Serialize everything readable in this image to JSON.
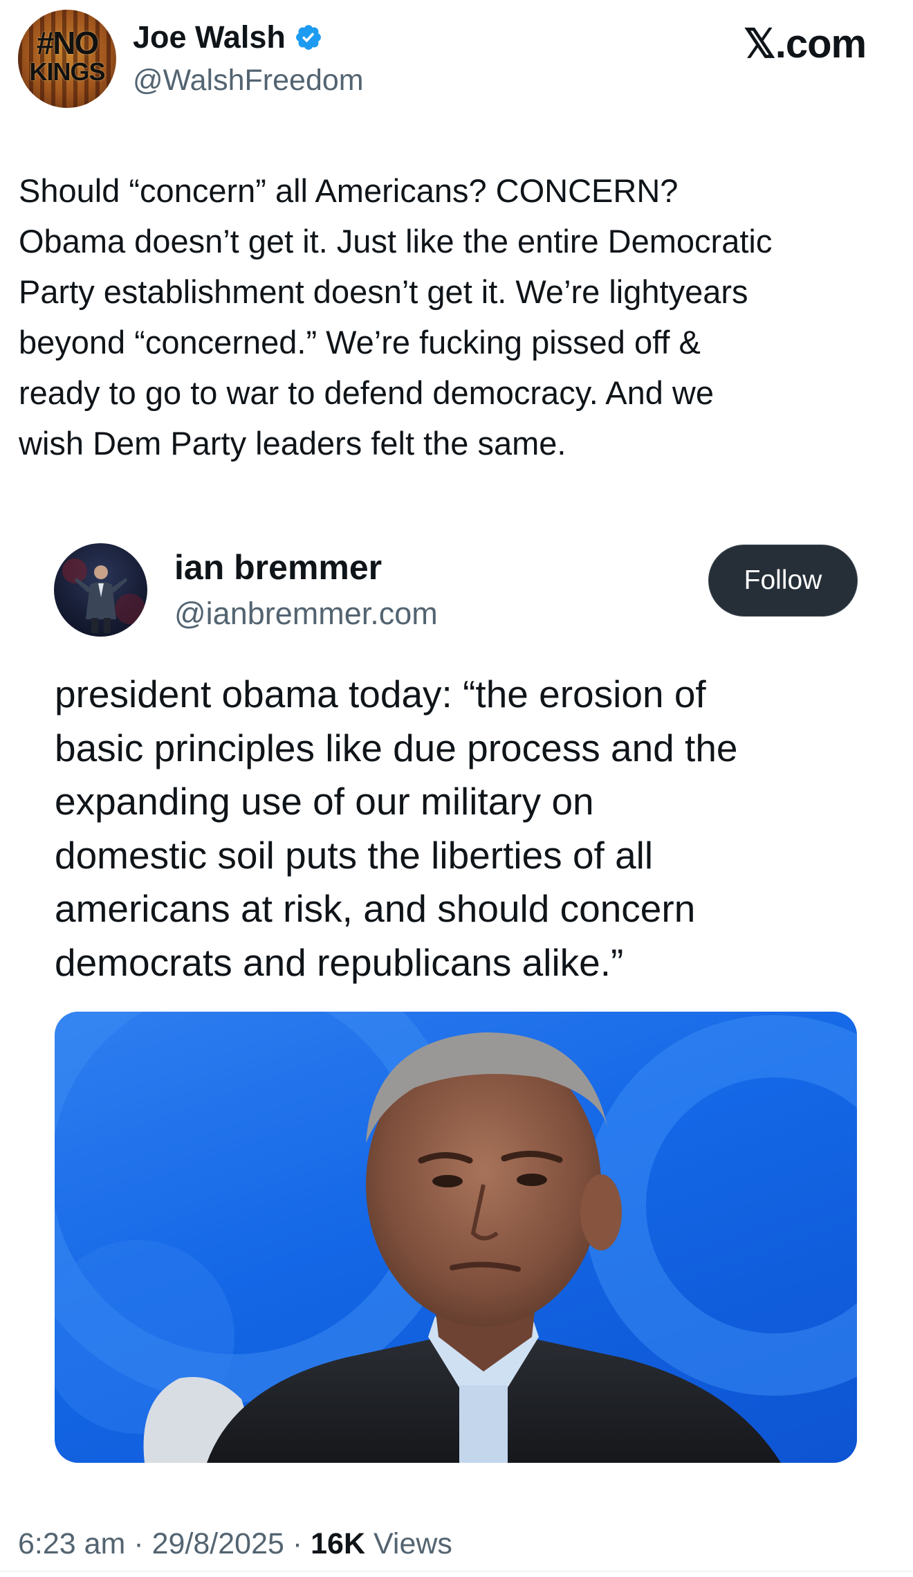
{
  "main_tweet": {
    "author_name": "Joe Walsh",
    "handle": "@WalshFreedom",
    "avatar_text": [
      "#NO",
      "KINGS"
    ],
    "verified_icon": "verified-badge-icon",
    "verified_color": "#1d9bf0",
    "lines": [
      "Should “concern” all Americans? CONCERN?",
      "Obama doesn’t get it. Just like the entire Democratic",
      "Party establishment doesn’t get it. We’re lightyears",
      "beyond “concerned.” We’re fucking pissed off &",
      "ready to go to war to defend democracy. And we",
      "wish Dem Party leaders felt the same."
    ]
  },
  "site_label": "𝕏.com",
  "quoted_tweet": {
    "author_name": "ian bremmer",
    "handle": "@ianbremmer.com",
    "follow_label": "Follow",
    "lines": [
      "president obama today: “the erosion of",
      "basic principles like due process and the",
      "expanding use of our military on",
      "domestic soil puts the liberties of all",
      "americans at risk, and should concern",
      "democrats and republicans alike.”"
    ]
  },
  "footer": {
    "time": "6:23 am",
    "separator": "·",
    "date": "29/8/2025",
    "views_count": "16K",
    "views_label": "Views"
  },
  "colors": {
    "text": "#0f1419",
    "secondary": "#536471",
    "follow_bg": "#262f38",
    "photo_bg": "#1467e6"
  }
}
